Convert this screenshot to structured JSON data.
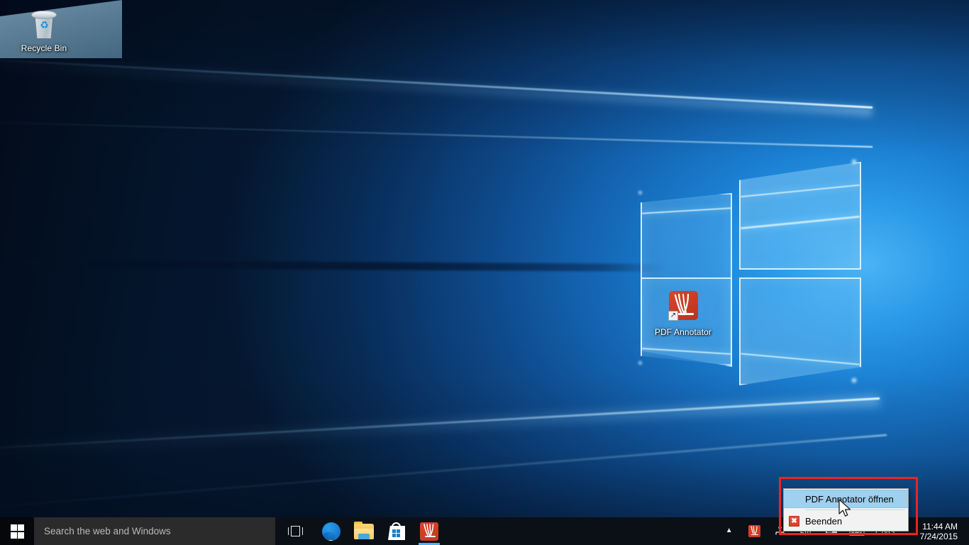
{
  "desktop": {
    "icons": [
      {
        "id": "recycle-bin",
        "label": "Recycle Bin",
        "icon": "recycle-bin-icon"
      },
      {
        "id": "pdf-annotator",
        "label": "PDF Annotator",
        "icon": "pdf-annotator-icon"
      }
    ]
  },
  "taskbar": {
    "start": {
      "label": "Start",
      "icon": "windows-logo-icon"
    },
    "search": {
      "placeholder": "Search the web and Windows",
      "value": ""
    },
    "buttons": [
      {
        "id": "task-view",
        "label": "Task View",
        "icon": "task-view-icon",
        "running": false
      },
      {
        "id": "edge",
        "label": "Microsoft Edge",
        "icon": "edge-icon",
        "running": false
      },
      {
        "id": "file-explorer",
        "label": "File Explorer",
        "icon": "folder-icon",
        "running": false
      },
      {
        "id": "store",
        "label": "Store",
        "icon": "store-bag-icon",
        "running": false
      },
      {
        "id": "pdf-annotator",
        "label": "PDF Annotator",
        "icon": "pdf-annotator-icon",
        "running": true
      }
    ],
    "tray": {
      "overflow_icon": "chevron-up-icon",
      "icons": [
        {
          "id": "pdf-annotator-tray",
          "label": "PDF Annotator",
          "icon": "pdf-annotator-icon"
        },
        {
          "id": "network",
          "label": "Network",
          "icon": "network-icon"
        },
        {
          "id": "volume",
          "label": "Volume",
          "icon": "speaker-icon"
        },
        {
          "id": "action-center",
          "label": "Action Center",
          "icon": "action-center-icon"
        },
        {
          "id": "touch-keyboard",
          "label": "Touch keyboard",
          "icon": "keyboard-icon"
        }
      ],
      "language": "ENG"
    },
    "clock": {
      "time": "11:44 AM",
      "date": "7/24/2015"
    }
  },
  "context_menu": {
    "name": "pdf-annotator-tray-context-menu",
    "items": [
      {
        "id": "open",
        "label": "PDF Annotator öffnen",
        "selected": true,
        "icon": null
      },
      {
        "id": "exit",
        "label": "Beenden",
        "selected": false,
        "icon": "close-x-icon",
        "icon_glyph": "✖"
      }
    ]
  },
  "annotation": {
    "highlight_color": "#ee2222",
    "name": "red-highlight-rectangle"
  },
  "colors": {
    "taskbar_bg": "#0b1016",
    "search_bg": "#2b2b2b",
    "menu_bg": "#f2f2f2",
    "menu_selected": "#9fd0ef",
    "accent_blue": "#4cb3f5",
    "brand_red": "#c9402a"
  }
}
